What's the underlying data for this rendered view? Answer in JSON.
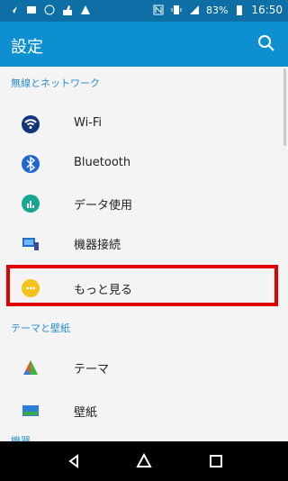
{
  "status_bar": {
    "battery_text": "83%",
    "time": "16:50",
    "icons": [
      "location-icon",
      "image-icon",
      "sync-icon",
      "thumb-icon",
      "warning-icon",
      "nfc-icon",
      "vibrate-icon",
      "signal-icon",
      "battery-icon"
    ]
  },
  "app_bar": {
    "title": "設定",
    "search_icon": "search-icon"
  },
  "sections": [
    {
      "header": "無線とネットワーク",
      "items": [
        {
          "label": "Wi-Fi",
          "icon": "wifi-icon",
          "color": "#11377a"
        },
        {
          "label": "Bluetooth",
          "icon": "bluetooth-icon",
          "color": "#1f67d0"
        },
        {
          "label": "データ使用",
          "icon": "data-usage-icon",
          "color": "#17a68e"
        },
        {
          "label": "機器接続",
          "icon": "device-connection-icon",
          "color": "#1f70c8"
        },
        {
          "label": "もっと見る",
          "icon": "more-icon",
          "color": "#f4c21a"
        }
      ]
    },
    {
      "header": "テーマと壁紙",
      "items": [
        {
          "label": "テーマ",
          "icon": "theme-icon",
          "color": "#e45b2a"
        },
        {
          "label": "壁紙",
          "icon": "wallpaper-icon",
          "color": "#2c7fd7"
        }
      ]
    },
    {
      "header": "機器",
      "items": []
    }
  ],
  "nav": {
    "back_icon": "back-icon",
    "home_icon": "home-icon",
    "recents_icon": "recents-icon"
  }
}
